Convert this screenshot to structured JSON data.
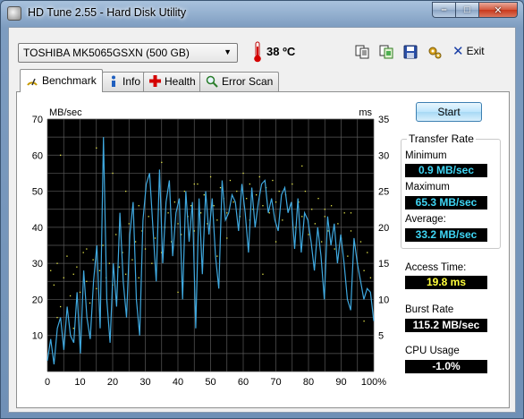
{
  "window": {
    "title": "HD Tune 2.55 - Hard Disk Utility",
    "minimize": "–",
    "maximize": "□",
    "close": "✕"
  },
  "toolbar": {
    "drive": "TOSHIBA MK5065GSXN (500 GB)",
    "temperature": "38 ºC",
    "icons": [
      "copy-text-icon",
      "copy-screenshot-icon",
      "save-icon",
      "options-icon"
    ],
    "exit_label": "Exit"
  },
  "tabs": [
    {
      "label": "Benchmark",
      "icon": "benchmark-icon",
      "active": true
    },
    {
      "label": "Info",
      "icon": "info-icon",
      "active": false
    },
    {
      "label": "Health",
      "icon": "health-icon",
      "active": false
    },
    {
      "label": "Error Scan",
      "icon": "error-scan-icon",
      "active": false
    }
  ],
  "benchmark": {
    "start_label": "Start",
    "transfer_rate_title": "Transfer Rate",
    "minimum_label": "Minimum",
    "minimum_value": "0.9 MB/sec",
    "maximum_label": "Maximum",
    "maximum_value": "65.3 MB/sec",
    "average_label": "Average:",
    "average_value": "33.2 MB/sec",
    "access_label": "Access Time:",
    "access_value": "19.8 ms",
    "burst_label": "Burst Rate",
    "burst_value": "115.2 MB/sec",
    "cpu_label": "CPU Usage",
    "cpu_value": "-1.0%"
  },
  "chart_data": {
    "type": "line",
    "ylabel_left": "MB/sec",
    "ylabel_right": "ms",
    "ylim_left": [
      0,
      70
    ],
    "ylim_right": [
      0,
      35
    ],
    "yticks_left": [
      "70",
      "60",
      "50",
      "40",
      "30",
      "20",
      "10"
    ],
    "yticks_right": [
      "35",
      "30",
      "25",
      "20",
      "15",
      "10",
      "5"
    ],
    "xticks": [
      "0",
      "10",
      "20",
      "30",
      "40",
      "50",
      "60",
      "70",
      "80",
      "90",
      "100%"
    ],
    "xlim": [
      0,
      100
    ],
    "grid": true,
    "colors": {
      "background": "#000000",
      "grid": "#5a5a5a",
      "transfer": "#3fa9e0",
      "access": "#e8e84a"
    },
    "series": [
      {
        "values": [
          3,
          9,
          2,
          12,
          15,
          6,
          18,
          10,
          8,
          22,
          5,
          28,
          15,
          9,
          25,
          35,
          12,
          65,
          20,
          8,
          30,
          18,
          44,
          25,
          15,
          38,
          47,
          20,
          10,
          42,
          52,
          55,
          40,
          25,
          56,
          30,
          47,
          53,
          32,
          44,
          48,
          20,
          50,
          36,
          47,
          12,
          48,
          27,
          50,
          38,
          48,
          32,
          23,
          53,
          42,
          44,
          49,
          47,
          39,
          52,
          44,
          33,
          51,
          40,
          47,
          52,
          53,
          44,
          48,
          42,
          39,
          49,
          51,
          44,
          47,
          34,
          48,
          33,
          44,
          42,
          36,
          28,
          40,
          32,
          20,
          43,
          35,
          41,
          30,
          38,
          30,
          20,
          17,
          37,
          30,
          25,
          20,
          23,
          22,
          14
        ]
      }
    ],
    "access_points": [
      [
        1,
        28
      ],
      [
        2,
        24
      ],
      [
        3,
        30
      ],
      [
        4,
        18
      ],
      [
        5,
        26
      ],
      [
        6,
        32
      ],
      [
        7,
        21
      ],
      [
        8,
        27
      ],
      [
        9,
        29
      ],
      [
        10,
        22
      ],
      [
        11,
        33
      ],
      [
        12,
        25
      ],
      [
        13,
        19
      ],
      [
        14,
        31
      ],
      [
        15,
        23
      ],
      [
        16,
        28
      ],
      [
        17,
        35
      ],
      [
        18,
        26
      ],
      [
        19,
        30
      ],
      [
        20,
        24
      ],
      [
        21,
        38
      ],
      [
        22,
        29
      ],
      [
        23,
        33
      ],
      [
        24,
        27
      ],
      [
        25,
        41
      ],
      [
        26,
        31
      ],
      [
        27,
        36
      ],
      [
        28,
        26
      ],
      [
        29,
        39
      ],
      [
        30,
        34
      ],
      [
        31,
        43
      ],
      [
        32,
        30
      ],
      [
        33,
        37
      ],
      [
        34,
        45
      ],
      [
        35,
        33
      ],
      [
        36,
        40
      ],
      [
        37,
        44
      ],
      [
        38,
        36
      ],
      [
        39,
        47
      ],
      [
        40,
        41
      ],
      [
        41,
        38
      ],
      [
        42,
        50
      ],
      [
        43,
        43
      ],
      [
        44,
        46
      ],
      [
        45,
        39
      ],
      [
        46,
        52
      ],
      [
        47,
        44
      ],
      [
        48,
        49
      ],
      [
        49,
        41
      ],
      [
        50,
        54
      ],
      [
        51,
        46
      ],
      [
        52,
        42
      ],
      [
        53,
        51
      ],
      [
        54,
        48
      ],
      [
        55,
        44
      ],
      [
        56,
        53
      ],
      [
        57,
        47
      ],
      [
        58,
        50
      ],
      [
        59,
        43
      ],
      [
        60,
        55
      ],
      [
        61,
        48
      ],
      [
        62,
        52
      ],
      [
        63,
        45
      ],
      [
        64,
        49
      ],
      [
        65,
        54
      ],
      [
        66,
        46
      ],
      [
        67,
        51
      ],
      [
        68,
        44
      ],
      [
        69,
        53
      ],
      [
        70,
        47
      ],
      [
        71,
        50
      ],
      [
        72,
        42
      ],
      [
        73,
        49
      ],
      [
        74,
        45
      ],
      [
        75,
        52
      ],
      [
        76,
        40
      ],
      [
        77,
        47
      ],
      [
        78,
        43
      ],
      [
        79,
        50
      ],
      [
        80,
        38
      ],
      [
        81,
        45
      ],
      [
        82,
        41
      ],
      [
        83,
        48
      ],
      [
        84,
        36
      ],
      [
        85,
        43
      ],
      [
        86,
        39
      ],
      [
        87,
        46
      ],
      [
        88,
        34
      ],
      [
        89,
        41
      ],
      [
        90,
        37
      ],
      [
        91,
        44
      ],
      [
        92,
        32
      ],
      [
        93,
        39
      ],
      [
        94,
        35
      ],
      [
        95,
        30
      ],
      [
        96,
        36
      ],
      [
        97,
        28
      ],
      [
        98,
        33
      ],
      [
        99,
        26
      ],
      [
        4,
        60
      ],
      [
        15,
        62
      ],
      [
        20,
        55
      ],
      [
        28,
        46
      ],
      [
        35,
        58
      ],
      [
        45,
        52
      ],
      [
        55,
        37
      ],
      [
        62,
        42
      ],
      [
        70,
        36
      ],
      [
        78,
        57
      ],
      [
        85,
        45
      ],
      [
        93,
        44
      ],
      [
        97,
        14
      ],
      [
        3,
        15
      ],
      [
        8,
        12
      ],
      [
        12,
        34
      ],
      [
        24,
        50
      ],
      [
        40,
        22
      ],
      [
        52,
        32
      ],
      [
        66,
        27
      ]
    ]
  }
}
